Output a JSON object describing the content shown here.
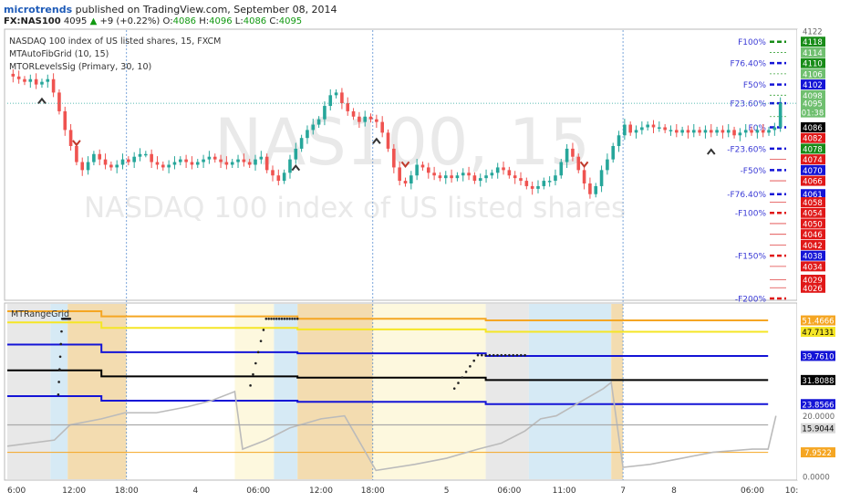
{
  "header": {
    "author": "microtrends",
    "published": "published on TradingView.com, September 08, 2014",
    "symbol": "FX:NAS100",
    "last": "4095",
    "change_arrow": "▲",
    "change": "+9 (+0.22%)",
    "o_label": "O:",
    "o_value": "4086",
    "h_label": "H:",
    "h_value": "4096",
    "l_label": "L:",
    "l_value": "4086",
    "c_label": "C:",
    "c_value": "4095"
  },
  "legend": {
    "title": "NASDAQ 100 index of US listed shares, 15, FXCM",
    "ind1": "MTAutoFibGrid (10, 15)",
    "ind2": "MTORLevelsSig (Primary, 30, 10)",
    "watermark1": "NAS100, 15",
    "watermark2": "NASDAQ 100 index of US listed shares",
    "lower_pane": "MTRangeGrid"
  },
  "time_axis": [
    "6:00",
    "12:00",
    "18:00",
    "4",
    "06:00",
    "12:00",
    "18:00",
    "5",
    "06:00",
    "11:00",
    "7",
    "8",
    "06:00",
    "10:"
  ],
  "colors": {
    "up": "#26a69a",
    "down": "#ef5350",
    "blue": "#1414d6",
    "green_tag": "#129212",
    "red_tag": "#e01818",
    "orange": "#f5a623",
    "yellow": "#f5e625",
    "black": "#000000",
    "gray": "#bbbbbb"
  },
  "chart_data": [
    {
      "type": "candlestick",
      "title": "NASDAQ 100 index of US listed shares, 15, FXCM",
      "ylim": [
        4022,
        4122
      ],
      "price_axis_labels": [
        "4122",
        "4118",
        "4114",
        "4110",
        "4106",
        "4102",
        "4098",
        "4095",
        "01:38",
        "4086",
        "4082",
        "4078",
        "4074",
        "4070",
        "4066",
        "4061",
        "4058",
        "4054",
        "4050",
        "4046",
        "4042",
        "4038",
        "4034",
        "4029",
        "4026"
      ],
      "fib_levels": [
        {
          "label": "F100%",
          "value": 4118
        },
        {
          "label": "F76.40%",
          "value": 4110
        },
        {
          "label": "F50%",
          "value": 4102
        },
        {
          "label": "F23.60%",
          "value": 4095
        },
        {
          "label": "F0%",
          "value": 4086
        },
        {
          "label": "-F23.60%",
          "value": 4078
        },
        {
          "label": "-F50%",
          "value": 4070
        },
        {
          "label": "-F76.40%",
          "value": 4061
        },
        {
          "label": "-F100%",
          "value": 4054
        },
        {
          "label": "-F150%",
          "value": 4038
        },
        {
          "label": "-F200%",
          "value": 4022
        }
      ],
      "close_path": [
        4106,
        4105,
        4104,
        4103,
        4104,
        4102,
        4103,
        4104,
        4099,
        4092,
        4085,
        4079,
        4073,
        4070,
        4073,
        4076,
        4074,
        4072,
        4071,
        4072,
        4074,
        4073,
        4075,
        4076,
        4076,
        4073,
        4072,
        4071,
        4072,
        4073,
        4074,
        4073,
        4072,
        4073,
        4074,
        4075,
        4074,
        4073,
        4072,
        4073,
        4074,
        4073,
        4072,
        4074,
        4075,
        4070,
        4068,
        4066,
        4069,
        4074,
        4078,
        4082,
        4085,
        4087,
        4089,
        4094,
        4098,
        4099,
        4095,
        4092,
        4090,
        4088,
        4090,
        4089,
        4088,
        4084,
        4078,
        4071,
        4066,
        4065,
        4068,
        4072,
        4071,
        4069,
        4068,
        4067,
        4068,
        4067,
        4068,
        4069,
        4068,
        4066,
        4067,
        4068,
        4069,
        4071,
        4070,
        4068,
        4067,
        4066,
        4064,
        4063,
        4064,
        4066,
        4066,
        4068,
        4073,
        4078,
        4075,
        4070,
        4065,
        4061,
        4064,
        4070,
        4074,
        4079,
        4083,
        4087,
        4084,
        4085,
        4086,
        4087,
        4086,
        4086,
        4085,
        4085,
        4084,
        4085,
        4084,
        4085,
        4084,
        4085,
        4084,
        4085,
        4084,
        4085,
        4083,
        4084,
        4085,
        4084,
        4085,
        4084,
        4085,
        4086,
        4095
      ],
      "signals": [
        {
          "dir": "up",
          "i": 6
        },
        {
          "dir": "down",
          "i": 12
        },
        {
          "dir": "up",
          "i": 50
        },
        {
          "dir": "up",
          "i": 64
        },
        {
          "dir": "down",
          "i": 69
        },
        {
          "dir": "down",
          "i": 100
        },
        {
          "dir": "up",
          "i": 122
        }
      ]
    },
    {
      "type": "line",
      "title": "MTRangeGrid",
      "ylim": [
        0,
        56
      ],
      "value_labels": [
        "51.4666",
        "47.7131",
        "39.7610",
        "31.8088",
        "23.8566",
        "20.0000",
        "15.9044",
        "7.9522",
        "0.0000"
      ],
      "series": [
        {
          "color": "#f5a623",
          "segments": [
            [
              0,
              0.12,
              54.5
            ],
            [
              0.12,
              0.37,
              52.8
            ],
            [
              0.37,
              0.61,
              52.0
            ],
            [
              0.61,
              0.97,
              51.47
            ]
          ]
        },
        {
          "color": "#f5e625",
          "segments": [
            [
              0,
              0.12,
              50.8
            ],
            [
              0.12,
              0.37,
              49.0
            ],
            [
              0.37,
              0.61,
              48.5
            ],
            [
              0.61,
              0.97,
              47.71
            ]
          ]
        },
        {
          "color": "#1414d6",
          "segments": [
            [
              0,
              0.12,
              43.5
            ],
            [
              0.12,
              0.37,
              41.0
            ],
            [
              0.37,
              0.61,
              40.6
            ],
            [
              0.61,
              0.97,
              39.76
            ]
          ]
        },
        {
          "color": "#000000",
          "segments": [
            [
              0,
              0.12,
              35.0
            ],
            [
              0.12,
              0.37,
              33.0
            ],
            [
              0.37,
              0.61,
              32.6
            ],
            [
              0.61,
              0.97,
              31.81
            ]
          ]
        },
        {
          "color": "#1414d6",
          "segments": [
            [
              0,
              0.12,
              26.5
            ],
            [
              0.12,
              0.37,
              25.0
            ],
            [
              0.37,
              0.61,
              24.6
            ],
            [
              0.61,
              0.97,
              23.86
            ]
          ]
        },
        {
          "color": "#f5a623",
          "segments": [
            [
              0,
              0.97,
              7.95
            ]
          ]
        }
      ]
    }
  ]
}
